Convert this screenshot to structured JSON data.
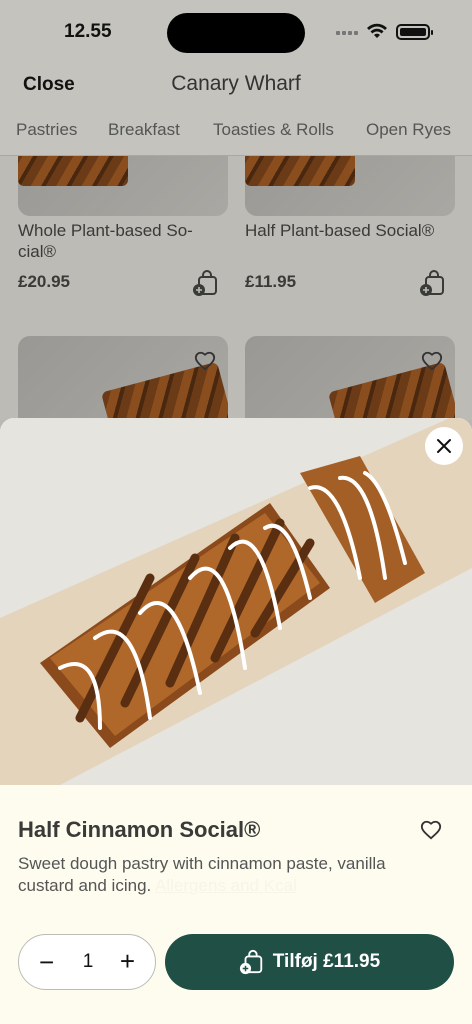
{
  "status": {
    "time": "12.55"
  },
  "header": {
    "close_label": "Close",
    "title": "Canary Wharf"
  },
  "tabs": [
    "Pastries",
    "Breakfast",
    "Toasties & Rolls",
    "Open Ryes"
  ],
  "grid": {
    "items": [
      {
        "name": "Whole Plant-based So-cial®",
        "price": "£20.95"
      },
      {
        "name": "Half Plant-based Social®",
        "price": "£11.95"
      }
    ]
  },
  "product": {
    "title": "Half Cinnamon Social®",
    "description": "Sweet dough pastry with cinnamon paste, vanilla custard and icing.",
    "link_text": "Allergens and Kcal",
    "quantity": "1",
    "add_label": "Tilføj £11.95"
  },
  "icons": {
    "close": "close-icon",
    "heart": "heart-icon",
    "bag": "add-to-bag-icon",
    "wifi": "wifi-icon",
    "battery": "battery-icon"
  },
  "colors": {
    "accent": "#1f4f45",
    "sheet_bg": "#fdfcef"
  }
}
